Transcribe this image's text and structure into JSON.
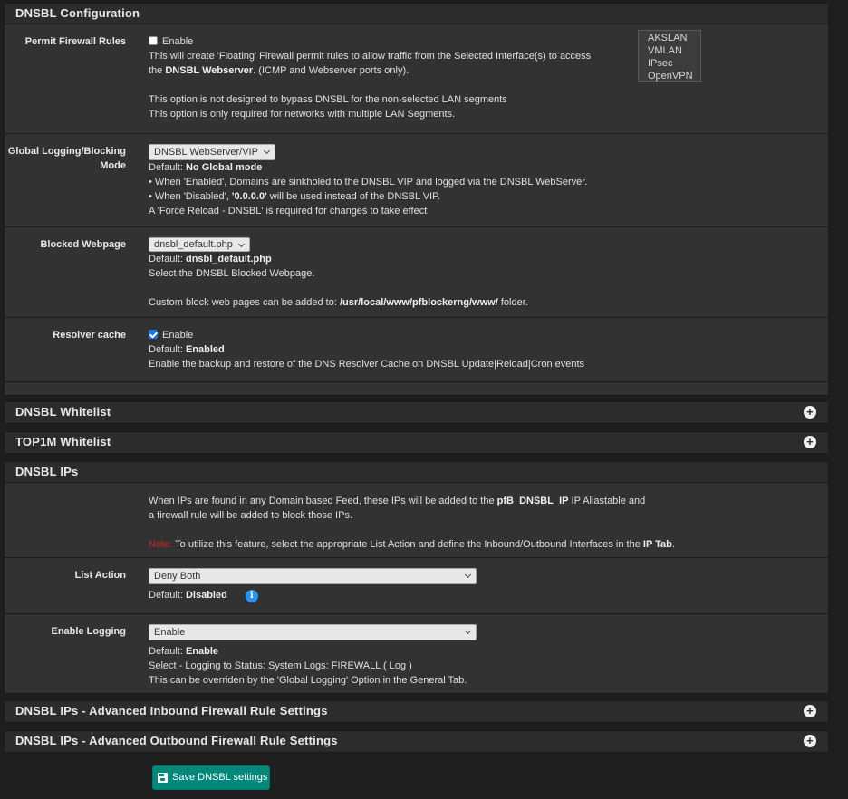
{
  "dnsbl_config": {
    "title": "DNSBL Configuration",
    "permit": {
      "label": "Permit Firewall Rules",
      "checkbox_label": "Enable",
      "desc_line1": "This will create 'Floating' Firewall permit rules to allow traffic from the Selected Interface(s) to access",
      "desc_line2_bold": "DNSBL Webserver",
      "desc_line2_pre": "the ",
      "desc_line2_post": ". (ICMP and Webserver ports only).",
      "desc_line3": "This option is not designed to bypass DNSBL for the non-selected LAN segments",
      "desc_line4": "This option is only required for networks with multiple LAN Segments.",
      "interfaces": [
        "AKSLAN",
        "VMLAN",
        "IPsec",
        "OpenVPN"
      ]
    },
    "global_logging": {
      "label_line1": "Global Logging/Blocking",
      "label_line2": "Mode",
      "selected": "DNSBL WebServer/VIP",
      "default_prefix": "Default: ",
      "default_value": "No Global mode",
      "line1": "• When 'Enabled', Domains are sinkholed to the DNSBL VIP and logged via the DNSBL WebServer.",
      "line2_pre": "• When 'Disabled', ",
      "line2_bold": "'0.0.0.0'",
      "line2_post": " will be used instead of the DNSBL VIP.",
      "line3": "A 'Force Reload - DNSBL' is required for changes to take effect"
    },
    "blocked_webpage": {
      "label": "Blocked Webpage",
      "selected": "dnsbl_default.php",
      "default_prefix": "Default: ",
      "default_value": "dnsbl_default.php",
      "line1": "Select the DNSBL Blocked Webpage.",
      "line2_pre": "Custom block web pages can be added to: ",
      "line2_bold": "/usr/local/www/pfblockerng/www/",
      "line2_post": " folder."
    },
    "resolver_cache": {
      "label": "Resolver cache",
      "checkbox_label": "Enable",
      "default_prefix": "Default: ",
      "default_value": "Enabled",
      "line1": "Enable the backup and restore of the DNS Resolver Cache on DNSBL Update|Reload|Cron events"
    }
  },
  "dnsbl_whitelist": {
    "title": "DNSBL Whitelist"
  },
  "top1m_whitelist": {
    "title": "TOP1M Whitelist"
  },
  "dnsbl_ips": {
    "title": "DNSBL IPs",
    "intro_line1_pre": "When IPs are found in any Domain based Feed, these IPs will be added to the ",
    "intro_line1_bold": "pfB_DNSBL_IP",
    "intro_line1_post": " IP Aliastable and",
    "intro_line2": "a firewall rule will be added to block those IPs.",
    "note_label": "Note:",
    "note_pre": " To utilize this feature, select the appropriate List Action and define the Inbound/Outbound Interfaces in the ",
    "note_bold": "IP Tab",
    "note_post": ".",
    "list_action": {
      "label": "List Action",
      "selected": "Deny Both",
      "default_prefix": "Default: ",
      "default_value": "Disabled"
    },
    "enable_logging": {
      "label": "Enable Logging",
      "selected": "Enable",
      "default_prefix": "Default: ",
      "default_value": "Enable",
      "line1": "Select - Logging to Status: System Logs: FIREWALL ( Log )",
      "line2": "This can be overriden by the 'Global Logging' Option in the General Tab."
    }
  },
  "adv_inbound": {
    "title": "DNSBL IPs - Advanced Inbound Firewall Rule Settings"
  },
  "adv_outbound": {
    "title": "DNSBL IPs - Advanced Outbound Firewall Rule Settings"
  },
  "save_button": {
    "label": "Save DNSBL settings"
  },
  "icons": {
    "expand": "plus-circle-icon",
    "save": "floppy-disk-icon",
    "info": "info-circle-icon"
  }
}
